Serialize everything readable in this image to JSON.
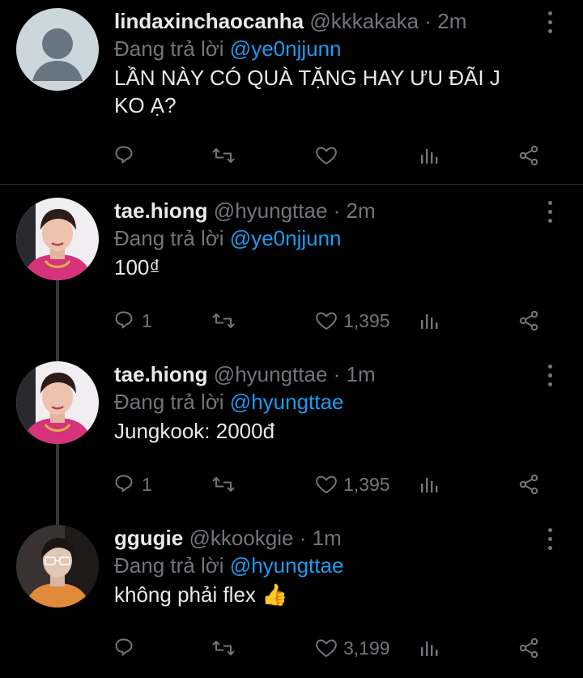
{
  "tweets": [
    {
      "username": "lindaxinchaocanha",
      "handle": "@kkkakaka",
      "dot": "·",
      "time": "2m",
      "reply_prefix": "Đang trả lời",
      "reply_to": "@ye0njjunn",
      "text": "LẦN NÀY CÓ QUÀ TẶNG HAY ƯU ĐÃI J KO Ạ?",
      "replies": "",
      "likes": "",
      "avatar": "default-avatar"
    },
    {
      "username": "tae.hiong",
      "handle": "@hyungttae",
      "dot": "·",
      "time": "2m",
      "reply_prefix": "Đang trả lời",
      "reply_to": "@ye0njjunn",
      "text": "100₫",
      "replies": "1",
      "likes": "1,395",
      "avatar": "photo-avatar-pink"
    },
    {
      "username": "tae.hiong",
      "handle": "@hyungttae",
      "dot": "·",
      "time": "1m",
      "reply_prefix": "Đang trả lời",
      "reply_to": "@hyungttae",
      "text": "Jungkook: 2000đ",
      "replies": "1",
      "likes": "1,395",
      "avatar": "photo-avatar-pink"
    },
    {
      "username": "ggugie",
      "handle": "@kkookgie",
      "dot": "·",
      "time": "1m",
      "reply_prefix": "Đang trả lời",
      "reply_to": "@hyungttae",
      "text": "không phải flex",
      "emoji": "👍",
      "replies": "",
      "likes": "3,199",
      "avatar": "photo-avatar-glasses"
    }
  ],
  "colors": {
    "background": "#000000",
    "text": "#e7e9ea",
    "muted": "#71767b",
    "link": "#1d9bf0",
    "divider": "#2f3336"
  },
  "icons": [
    "reply-icon",
    "retweet-icon",
    "like-icon",
    "views-icon",
    "share-icon",
    "more-icon"
  ]
}
